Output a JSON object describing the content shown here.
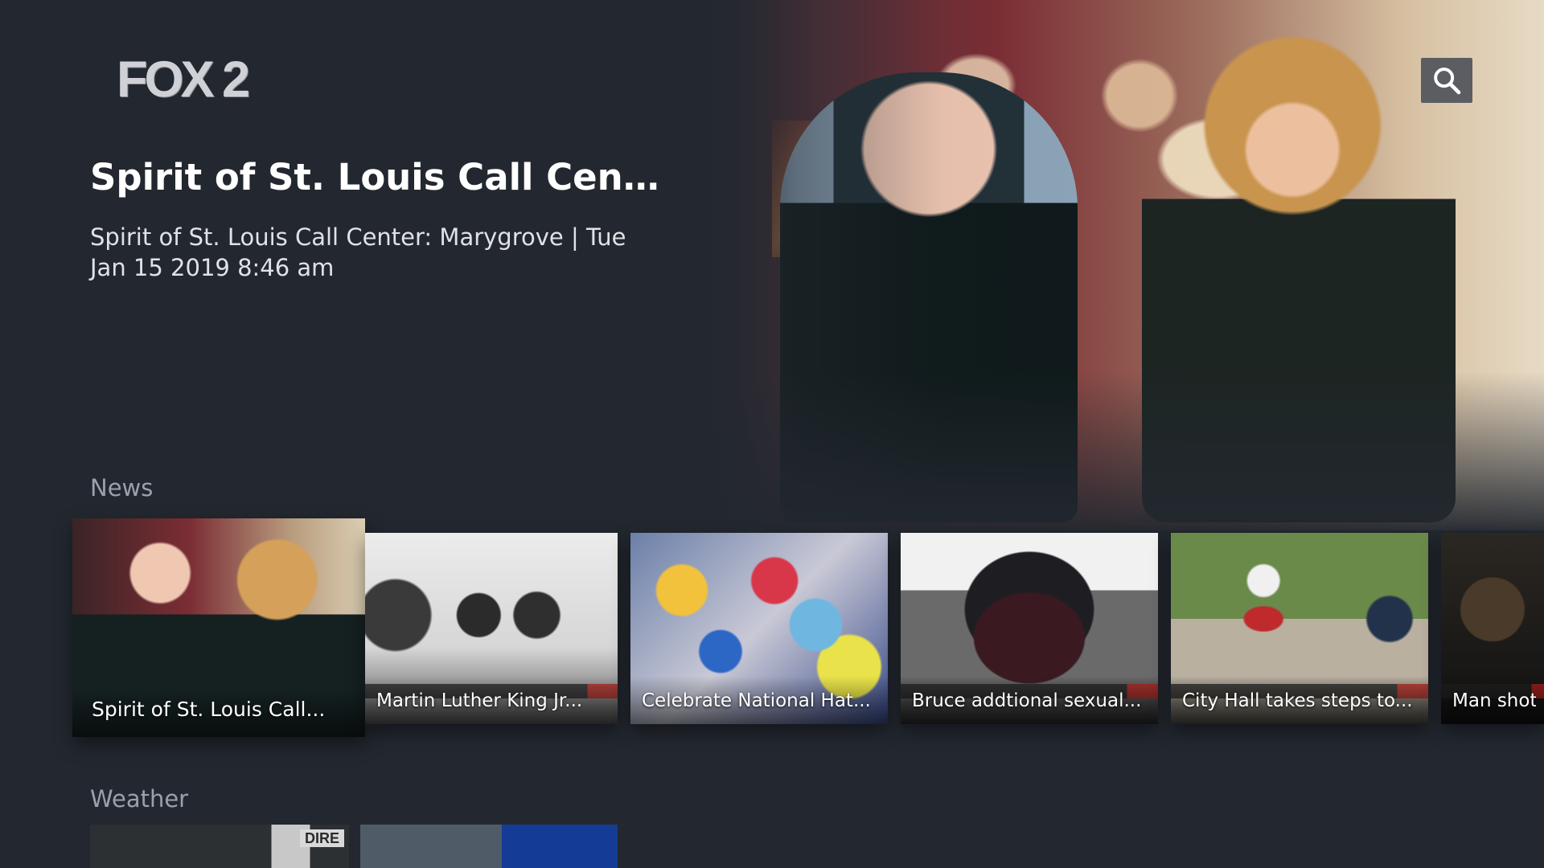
{
  "app": {
    "logo_text": "FOX 2"
  },
  "header": {
    "search_icon": "search-icon"
  },
  "hero": {
    "title": "Spirit of St. Louis Call Center:...",
    "description": "Spirit of St. Louis Call Center: Marygrove | Tue Jan 15 2019 8:46 am"
  },
  "sections": {
    "news": {
      "label": "News",
      "cards": [
        {
          "caption": "Spirit of St. Louis Call..."
        },
        {
          "caption": "Martin Luther King Jr..."
        },
        {
          "caption": "Celebrate National Hat..."
        },
        {
          "caption": "Bruce addtional sexual..."
        },
        {
          "caption": "City Hall takes steps to..."
        },
        {
          "caption": "Man shot"
        }
      ]
    },
    "weather": {
      "label": "Weather",
      "cards": [
        {
          "tag": "DIRE"
        },
        {
          "tag": ""
        }
      ]
    }
  },
  "colors": {
    "background": "#232830",
    "search_button": "#5b5d62",
    "section_label": "#9aa1ab"
  }
}
